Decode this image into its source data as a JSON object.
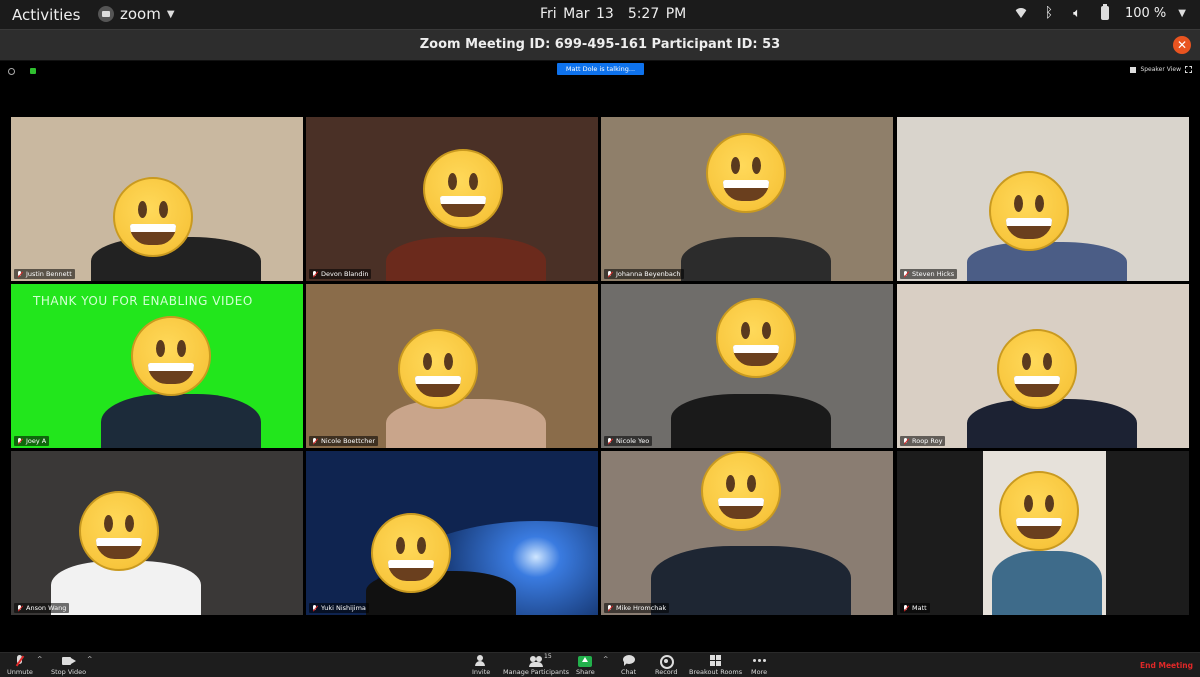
{
  "system_bar": {
    "activities": "Activities",
    "app_name": "zoom",
    "date": "Fri Mar 13",
    "time": "5:27 PM",
    "battery": "100 %"
  },
  "window": {
    "title": "Zoom Meeting ID: 699-495-161 Participant ID: 53"
  },
  "meeting": {
    "talking_indicator": "Matt Dole is talking...",
    "view_mode": "Speaker View",
    "banner_text": "THANK YOU FOR ENABLING VIDEO"
  },
  "participants": [
    {
      "name": "Justin Bennett",
      "muted": true,
      "bg": "#c9b8a0"
    },
    {
      "name": "Devon Blandin",
      "muted": true,
      "bg": "#4a3026"
    },
    {
      "name": "Johanna Beyenbach",
      "muted": true,
      "bg": "#8f7f6a"
    },
    {
      "name": "Steven Hicks",
      "muted": true,
      "bg": "#d9d4cc"
    },
    {
      "name": "Joey A",
      "muted": true,
      "bg": "#22e61c"
    },
    {
      "name": "Nicole Boettcher",
      "muted": true,
      "bg": "#8a6c4a"
    },
    {
      "name": "Nicole Yeo",
      "muted": true,
      "bg": "#6f6d6a"
    },
    {
      "name": "Roop Roy",
      "muted": true,
      "bg": "#d9cfc4"
    },
    {
      "name": "Anson Wang",
      "muted": true,
      "bg": "#3a3837"
    },
    {
      "name": "Yuki Nishijima",
      "muted": true,
      "bg": "#0f2450"
    },
    {
      "name": "Mike Hromchak",
      "muted": true,
      "bg": "#8a7d72"
    },
    {
      "name": "Matt",
      "muted": true,
      "bg": "#1c1c1c"
    }
  ],
  "toolbar": {
    "unmute": "Unmute",
    "stop_video": "Stop Video",
    "invite": "Invite",
    "manage_participants": "Manage Participants",
    "participant_count": "15",
    "share": "Share",
    "chat": "Chat",
    "record": "Record",
    "breakout_rooms": "Breakout Rooms",
    "more": "More",
    "end_meeting": "End Meeting"
  }
}
